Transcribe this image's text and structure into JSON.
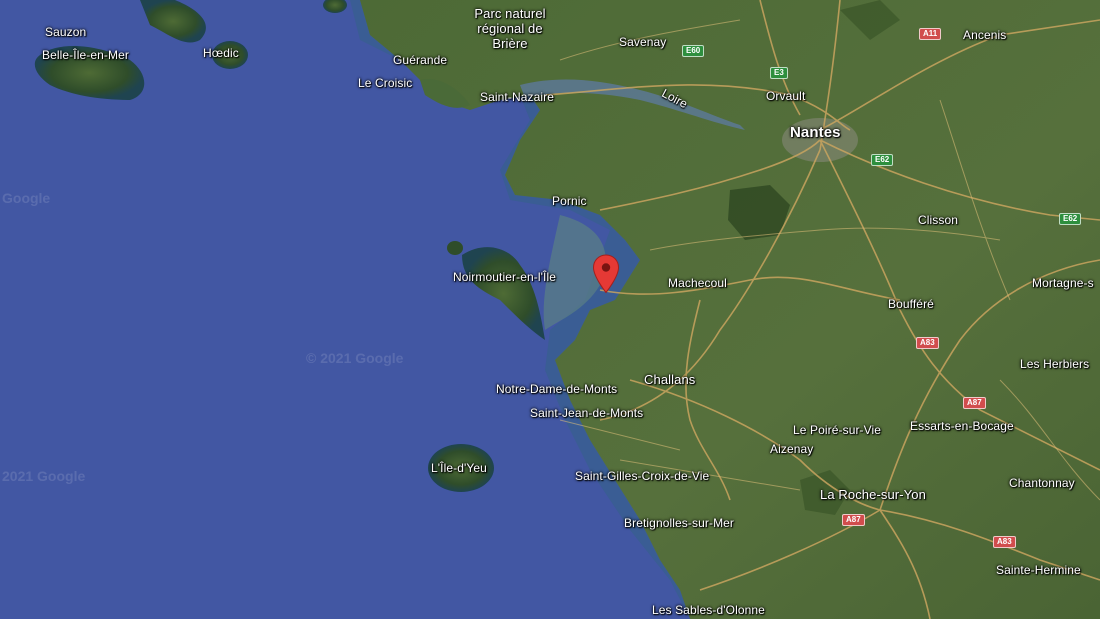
{
  "map": {
    "colors": {
      "sea": "#4257a3",
      "land": "#4b6535",
      "land_dark": "#334a26",
      "road": "#c9a45f",
      "pin": "#e53935"
    },
    "watermarks": [
      "Google",
      "© 2021 Google",
      "2021 Google"
    ],
    "labels": {
      "sauzon": "Sauzon",
      "belle_ile": "Belle-Île-en-Mer",
      "hoedic": "Hœdic",
      "parc": "Parc naturel régional de Brière",
      "guerande": "Guérande",
      "le_croisic": "Le Croisic",
      "saint_nazaire": "Saint-Nazaire",
      "savenay": "Savenay",
      "loire": "Loire",
      "orvault": "Orvault",
      "nantes": "Nantes",
      "ancenis": "Ancenis",
      "pornic": "Pornic",
      "clisson": "Clisson",
      "noirmoutier": "Noirmoutier-en-l'Île",
      "machecoul": "Machecoul",
      "mortagne": "Mortagne-s",
      "bouffere": "Boufféré",
      "les_herbiers": "Les Herbiers",
      "notre_dame": "Notre-Dame-de-Monts",
      "challans": "Challans",
      "saint_jean": "Saint-Jean-de-Monts",
      "essarts": "Essarts-en-Bocage",
      "le_poire": "Le Poiré-sur-Vie",
      "aizenay": "Aizenay",
      "ile_yeu": "L'Île-d'Yeu",
      "saint_gilles": "Saint-Gilles-Croix-de-Vie",
      "chantonnay": "Chantonnay",
      "la_roche": "La Roche-sur-Yon",
      "bretignolles": "Bretignolles-sur-Mer",
      "sainte_hermine": "Sainte-Hermine",
      "les_sables": "Les Sables-d'Olonne"
    },
    "shields": {
      "a11": "A11",
      "e60": "E60",
      "e3": "E3",
      "e62_north": "E62",
      "e62_east": "E62",
      "a83_north": "A83",
      "a87_north": "A87",
      "a87_south": "A87",
      "a83_south": "A83"
    },
    "marker": "location-pin-icon"
  }
}
